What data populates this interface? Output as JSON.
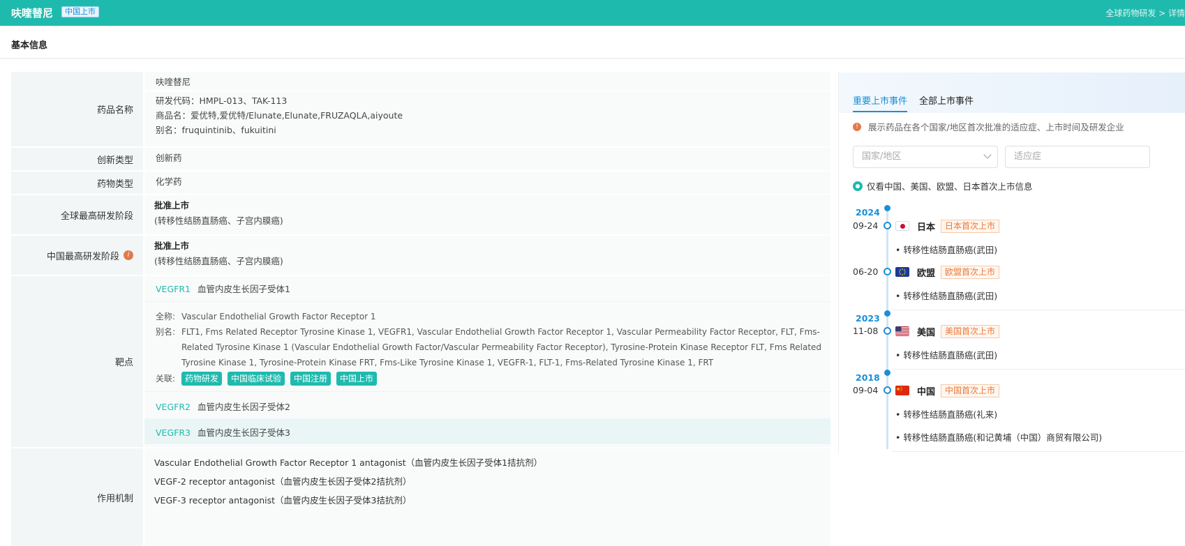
{
  "header": {
    "drug_name": "呋喹替尼",
    "status_badge": "中国上市",
    "breadcrumb": "全球药物研发 > 详情"
  },
  "section": {
    "title": "基本信息"
  },
  "table": {
    "drug_name": {
      "label": "药品名称",
      "name": "呋喹替尼",
      "code": "研发代码：HMPL-013、TAK-113",
      "trade": "商品名：爱优特,爱优特/Elunate,Elunate,FRUZAQLA,aiyoute",
      "alias": "别名：fruquintinib、fukuitini"
    },
    "innovation_type": {
      "label": "创新类型",
      "value": "创新药"
    },
    "drug_type": {
      "label": "药物类型",
      "value": "化学药"
    },
    "global_phase": {
      "label": "全球最高研发阶段",
      "value": "批准上市",
      "note": "(转移性结肠直肠癌、子宫内膜癌)"
    },
    "china_phase": {
      "label": "中国最高研发阶段",
      "value": "批准上市",
      "note": "(转移性结肠直肠癌、子宫内膜癌)"
    },
    "target": {
      "label": "靶点",
      "items": [
        {
          "code": "VEGFR1",
          "name": "血管内皮生长因子受体1"
        },
        {
          "code": "VEGFR2",
          "name": "血管内皮生长因子受体2"
        },
        {
          "code": "VEGFR3",
          "name": "血管内皮生长因子受体3"
        }
      ],
      "detail": {
        "full_key": "全称:",
        "full": "Vascular Endothelial Growth Factor Receptor 1",
        "alias_key": "别名:",
        "alias": "FLT1, Fms Related Receptor Tyrosine Kinase 1, VEGFR1, Vascular Endothelial Growth Factor Receptor 1, Vascular Permeability Factor Receptor, FLT, Fms-Related Tyrosine Kinase 1 (Vascular Endothelial Growth Factor/Vascular Permeability Factor Receptor), Tyrosine-Protein Kinase Receptor FLT, Fms Related Tyrosine Kinase 1, Tyrosine-Protein Kinase FRT, Fms-Like Tyrosine Kinase 1, VEGFR-1, FLT-1, Fms-Related Tyrosine Kinase 1, FRT",
        "rel_key": "关联:",
        "chips": [
          "药物研发",
          "中国临床试验",
          "中国注册",
          "中国上市"
        ]
      }
    },
    "mechanism": {
      "label": "作用机制",
      "lines": [
        "Vascular Endothelial Growth Factor Receptor 1 antagonist（血管内皮生长因子受体1拮抗剂）",
        "VEGF-2 receptor antagonist（血管内皮生长因子受体2拮抗剂）",
        "VEGF-3 receptor antagonist（血管内皮生长因子受体3拮抗剂）"
      ]
    }
  },
  "panel": {
    "tabs": [
      "重要上市事件",
      "全部上市事件"
    ],
    "hint": "展示药品在各个国家/地区首次批准的适应症、上市时间及研发企业",
    "filter_country_placeholder": "国家/地区",
    "filter_indication_placeholder": "适应症",
    "radio_label": "仅看中国、美国、欧盟、日本首次上市信息",
    "timeline": {
      "y2024": "2024",
      "y2023": "2023",
      "y2018": "2018",
      "events": [
        {
          "date": "09-24",
          "country": "日本",
          "tag": "日本首次上市",
          "indications": [
            "• 转移性结肠直肠癌(武田)"
          ]
        },
        {
          "date": "06-20",
          "country": "欧盟",
          "tag": "欧盟首次上市",
          "indications": [
            "• 转移性结肠直肠癌(武田)"
          ]
        },
        {
          "date": "11-08",
          "country": "美国",
          "tag": "美国首次上市",
          "indications": [
            "• 转移性结肠直肠癌(武田)"
          ]
        },
        {
          "date": "09-04",
          "country": "中国",
          "tag": "中国首次上市",
          "indications": [
            "• 转移性结肠直肠癌(礼来)",
            "• 转移性结肠直肠癌(和记黄埔（中国）商贸有限公司)"
          ]
        }
      ]
    },
    "colors": {
      "accent": "#1a8fd6",
      "brand": "#1fbaae",
      "tag": "#e8793b"
    }
  }
}
